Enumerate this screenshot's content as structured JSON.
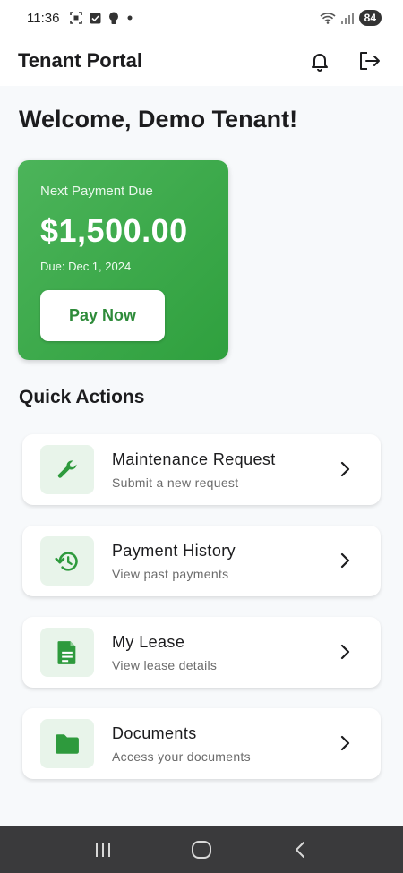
{
  "status_bar": {
    "time": "11:36",
    "battery": "84",
    "icons": [
      "screenshot-icon",
      "check-box-icon",
      "bulb-icon",
      "dot-icon",
      "wifi-icon",
      "signal-icon"
    ]
  },
  "app_bar": {
    "title": "Tenant Portal",
    "actions": [
      "bell-icon",
      "logout-icon"
    ]
  },
  "welcome": "Welcome, Demo Tenant!",
  "payment_card": {
    "label": "Next Payment Due",
    "amount": "$1,500.00",
    "due": "Due: Dec 1, 2024",
    "button": "Pay Now"
  },
  "quick_actions": {
    "title": "Quick Actions",
    "items": [
      {
        "title": "Maintenance Request",
        "subtitle": "Submit a new request",
        "icon": "wrench-icon"
      },
      {
        "title": "Payment History",
        "subtitle": "View past payments",
        "icon": "history-icon"
      },
      {
        "title": "My Lease",
        "subtitle": "View lease details",
        "icon": "document-icon"
      },
      {
        "title": "Documents",
        "subtitle": "Access your documents",
        "icon": "folder-icon"
      }
    ]
  },
  "colors": {
    "accent": "#2fa03e",
    "accent_light": "#e8f4ea",
    "icon_green": "#2e9a3d",
    "nav_bar": "#3a3a3c"
  },
  "nav_bar": [
    "recents-icon",
    "home-icon",
    "back-icon"
  ]
}
